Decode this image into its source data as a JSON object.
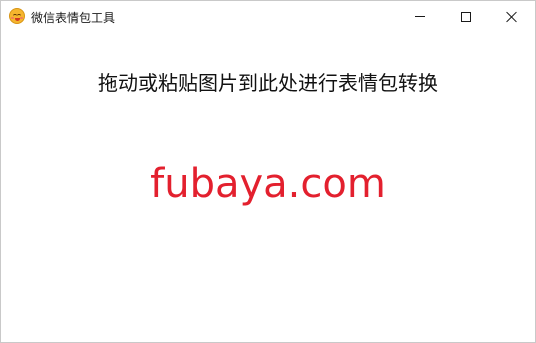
{
  "window": {
    "title": "微信表情包工具",
    "icon": "emoji-face-icon",
    "controls": {
      "minimize": "minimize-icon",
      "maximize": "maximize-icon",
      "close": "close-icon"
    }
  },
  "main": {
    "instruction": "拖动或粘贴图片到此处进行表情包转换",
    "watermark": "fubaya.com"
  },
  "colors": {
    "watermark": "#e3202e",
    "background": "#ffffff"
  }
}
